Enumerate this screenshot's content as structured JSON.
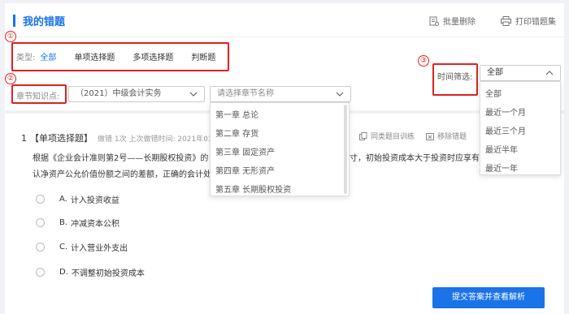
{
  "header": {
    "title": "我的错题",
    "batch_delete": "批量删除",
    "print": "打印错题集"
  },
  "markers": [
    "①",
    "②",
    "③"
  ],
  "type_filter": {
    "label": "类型:",
    "options": [
      "全部",
      "单项选择题",
      "多项选择题",
      "判断题"
    ]
  },
  "chapter_filter": {
    "label": "章节知识点:",
    "course": "（2021）中级会计实务",
    "chapter_placeholder": "请选择章节名称",
    "chapters": [
      "第一章 总论",
      "第二章 存货",
      "第三章 固定资产",
      "第四章 无形资产",
      "第五章 长期股权投资"
    ]
  },
  "time_filter": {
    "label": "时间筛选:",
    "selected": "全部",
    "options": [
      "全部",
      "最近一个月",
      "最近三个月",
      "最近半年",
      "最近一年"
    ]
  },
  "question": {
    "number": "1",
    "type": "【单项选择题】",
    "meta": "做错 1次 上次做错时间: 2021年03月1",
    "line1": "根据《企业会计准则第2号——长期股权投资》的",
    "line1_tail": "寸，初始投资成本大于投资时应享有被",
    "line2": "认净资产公允价值份额之间的差额，正确的会计处",
    "actions": {
      "similar": "同类题目训练",
      "remove": "移除错题"
    },
    "options": [
      {
        "letter": "A.",
        "text": "计入投资收益"
      },
      {
        "letter": "B.",
        "text": "冲减资本公积"
      },
      {
        "letter": "C.",
        "text": "计入营业外支出"
      },
      {
        "letter": "D.",
        "text": "不调整初始投资成本"
      }
    ]
  },
  "submit_label": "提交答案并查看解析",
  "colors": {
    "accent": "#1a73e8",
    "highlight": "#e02020"
  }
}
